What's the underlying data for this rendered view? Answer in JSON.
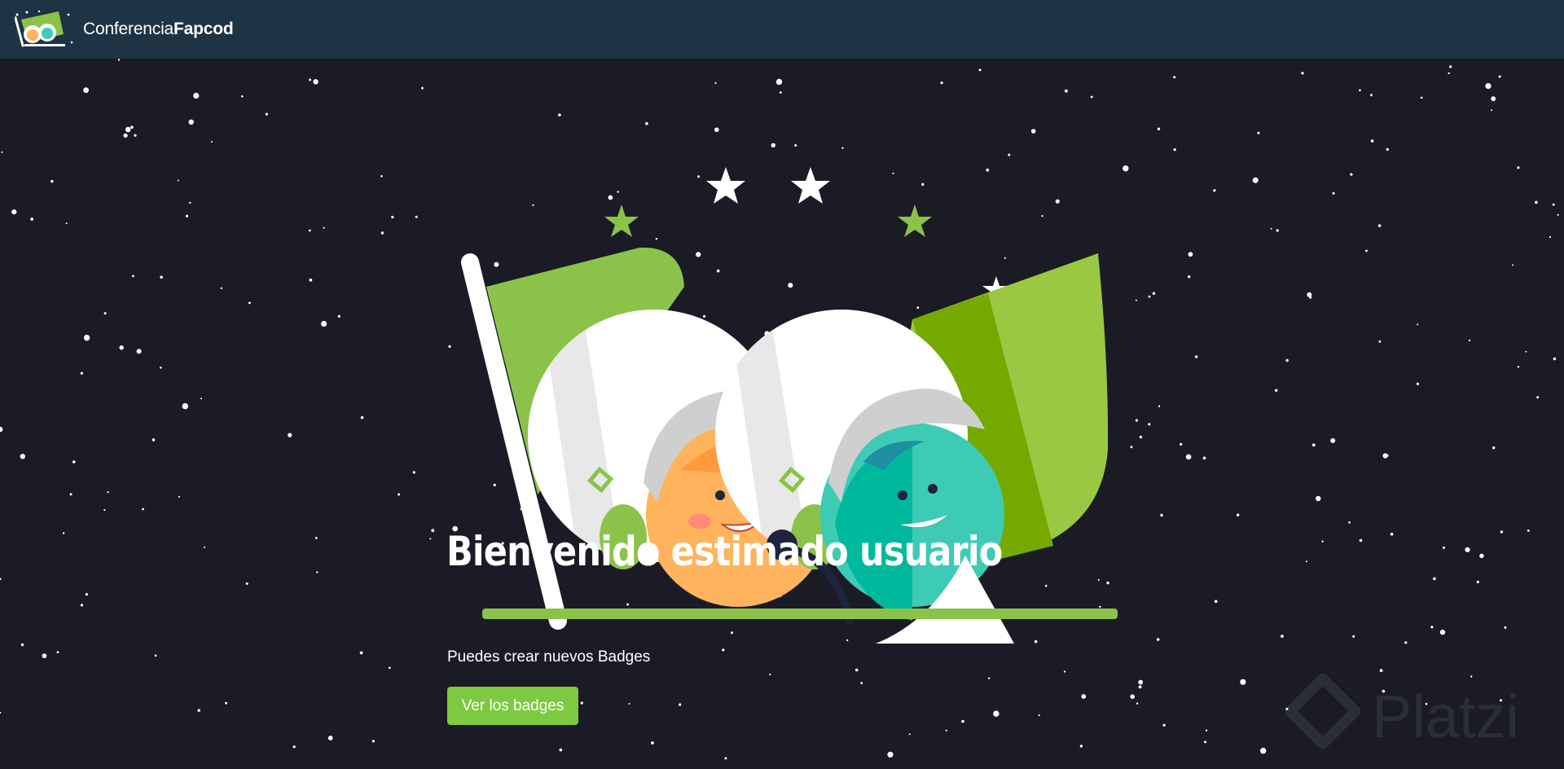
{
  "navbar": {
    "brand_light": "Conferencia",
    "brand_bold": "Fapcod",
    "logo_icon": "conference-flag-logo-icon"
  },
  "hero": {
    "title": "Bienvenido estimado usuario",
    "subtitle": "Puedes crear nuevos Badges",
    "button_label": "Ver los badges",
    "illustration_icon": "astronauts-with-flag-illustration"
  },
  "watermark": {
    "text": "Platzi"
  },
  "colors": {
    "navbar_bg": "#1e3344",
    "page_bg": "#1b1b25",
    "accent_green": "#7dc940",
    "dark_green": "#78a800",
    "orange_face": "#ffb35c",
    "teal_face": "#3ecbb6"
  }
}
